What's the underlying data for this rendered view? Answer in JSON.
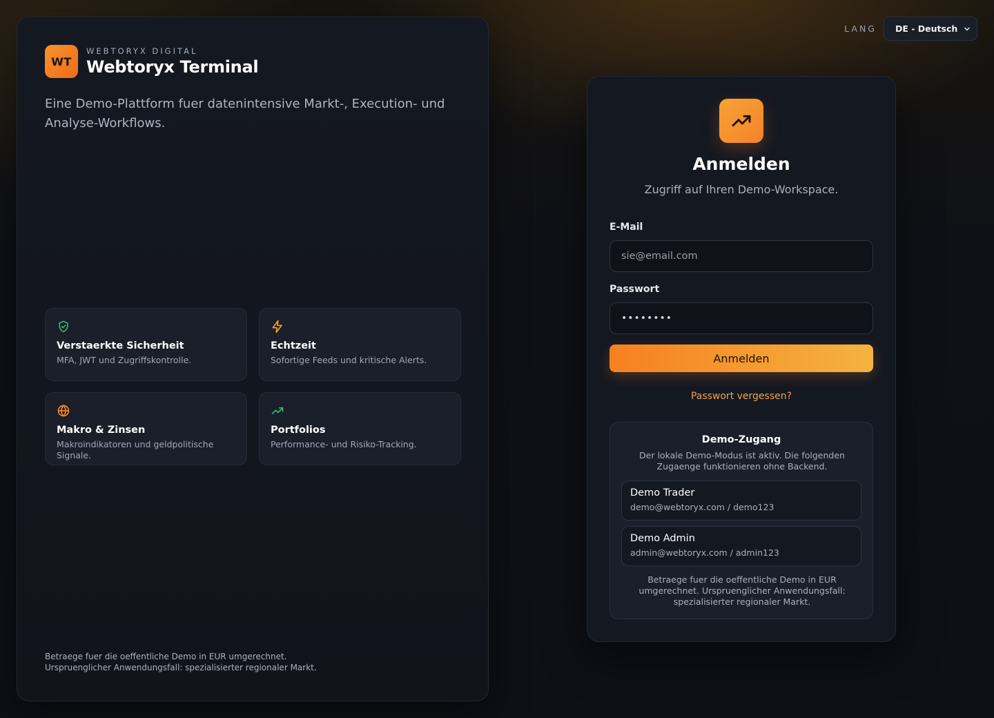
{
  "brand": {
    "logo_text": "WT",
    "company": "WEBTORYX DIGITAL",
    "title": "Webtoryx Terminal"
  },
  "tagline": "Eine Demo-Plattform fuer datenintensive Markt-, Execution- und Analyse-Workflows.",
  "features": [
    {
      "icon": "shield-check-icon",
      "icon_color": "#2fbf71",
      "title": "Verstaerkte Sicherheit",
      "description": "MFA, JWT und Zugriffskontrolle."
    },
    {
      "icon": "lightning-icon",
      "icon_color": "#f5a524",
      "title": "Echtzeit",
      "description": "Sofortige Feeds und kritische Alerts."
    },
    {
      "icon": "globe-icon",
      "icon_color": "#f5882a",
      "title": "Makro & Zinsen",
      "description": "Makroindikatoren und geldpolitische Signale."
    },
    {
      "icon": "trending-up-icon",
      "icon_color": "#2fbf71",
      "title": "Portfolios",
      "description": "Performance- und Risiko-Tracking."
    }
  ],
  "footnote": {
    "line1": "Betraege fuer die oeffentliche Demo in EUR umgerechnet.",
    "line2": "Urspruenglicher Anwendungsfall: spezialisierter regionaler Markt."
  },
  "lang": {
    "label": "LANG",
    "selected": "DE - Deutsch"
  },
  "login": {
    "icon": "trending-up-icon",
    "title": "Anmelden",
    "subtitle": "Zugriff auf Ihren Demo-Workspace.",
    "email_label": "E-Mail",
    "email_placeholder": "sie@email.com",
    "password_label": "Passwort",
    "password_value": "••••••••",
    "submit_label": "Anmelden",
    "forgot_label": "Passwort vergessen?"
  },
  "demo": {
    "title": "Demo-Zugang",
    "description": "Der lokale Demo-Modus ist aktiv. Die folgenden Zugaenge funktionieren ohne Backend.",
    "accounts": [
      {
        "name": "Demo Trader",
        "credentials": "demo@webtoryx.com / demo123"
      },
      {
        "name": "Demo Admin",
        "credentials": "admin@webtoryx.com / admin123"
      }
    ],
    "note": "Betraege fuer die oeffentliche Demo in EUR umgerechnet. Urspruenglicher Anwendungsfall: spezialisierter regionaler Markt."
  },
  "colors": {
    "accent": "#f6801f",
    "accent_light": "#f4b340",
    "background": "#0f1117",
    "card": "#141821"
  }
}
